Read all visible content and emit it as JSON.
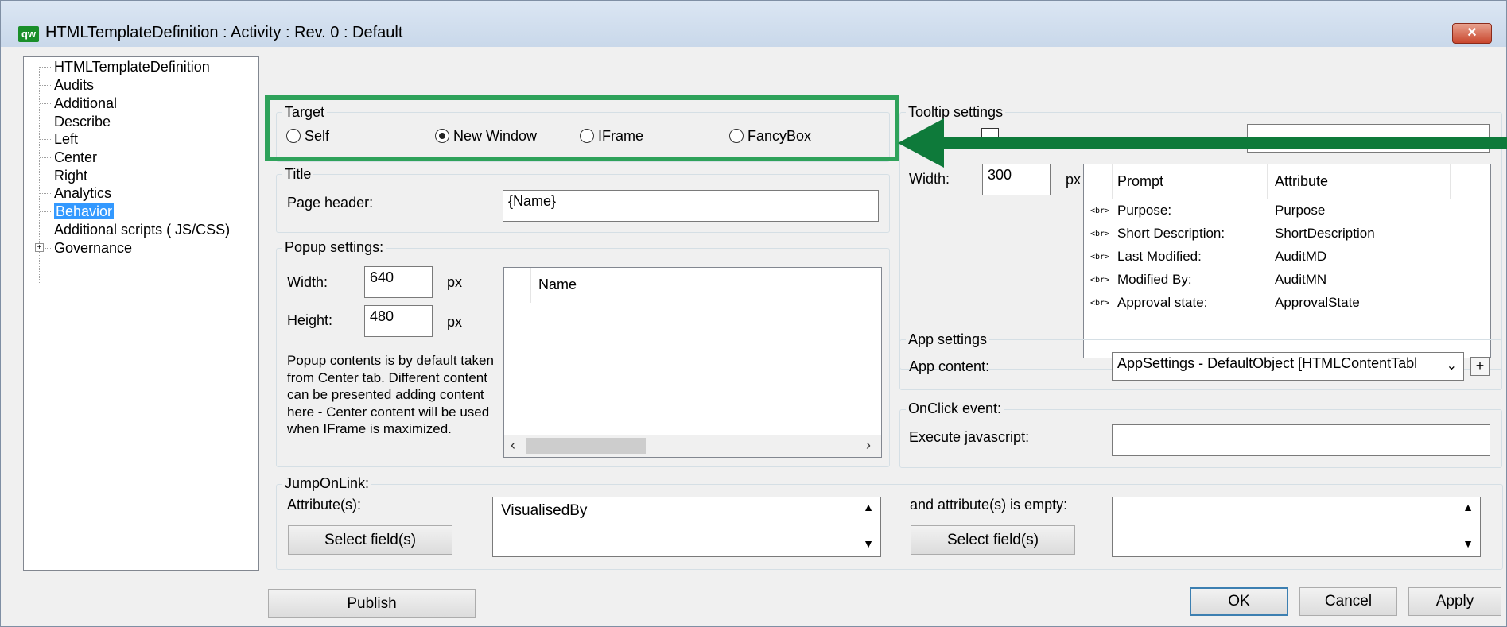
{
  "window": {
    "title": "HTMLTemplateDefinition : Activity : Rev. 0  : Default",
    "icon_text": "qw",
    "close_glyph": "✕"
  },
  "tree": {
    "items": [
      {
        "label": "HTMLTemplateDefinition"
      },
      {
        "label": "Audits"
      },
      {
        "label": "Additional"
      },
      {
        "label": "Describe"
      },
      {
        "label": "Left"
      },
      {
        "label": "Center"
      },
      {
        "label": "Right"
      },
      {
        "label": "Analytics"
      },
      {
        "label": "Behavior"
      },
      {
        "label": "Additional scripts ( JS/CSS)"
      },
      {
        "label": "Governance"
      }
    ],
    "selected": "Behavior"
  },
  "target": {
    "legend": "Target",
    "options": [
      {
        "label": "Self",
        "checked": false
      },
      {
        "label": "New Window",
        "checked": true
      },
      {
        "label": "IFrame",
        "checked": false
      },
      {
        "label": "FancyBox",
        "checked": false
      }
    ]
  },
  "title_group": {
    "legend": "Title",
    "page_header_label": "Page header:",
    "page_header_value": "{Name}"
  },
  "popup": {
    "legend": "Popup settings:",
    "width_label": "Width:",
    "width_value": "640",
    "height_label": "Height:",
    "height_value": "480",
    "unit": "px",
    "note": "Popup contents is by default taken from Center tab. Different content can be presented adding content here - Center content will be used when IFrame is maximized.",
    "list_header": "Name"
  },
  "jump": {
    "legend": "JumpOnLink:",
    "attr_label": "Attribute(s):",
    "attr_value": "VisualisedBy",
    "select_btn": "Select field(s)",
    "empty_label": "and attribute(s) is empty:",
    "select_btn2": "Select field(s)"
  },
  "tooltip": {
    "legend": "Tooltip settings",
    "width_label": "Width:",
    "width_value": "300",
    "unit": "px",
    "headers": {
      "prompt": "Prompt",
      "attribute": "Attribute"
    },
    "br_tag": "<br>",
    "rows": [
      {
        "prompt": "Purpose:",
        "attribute": "Purpose"
      },
      {
        "prompt": "Short Description:",
        "attribute": "ShortDescription"
      },
      {
        "prompt": "Last Modified:",
        "attribute": "AuditMD"
      },
      {
        "prompt": "Modified By:",
        "attribute": "AuditMN"
      },
      {
        "prompt": "Approval state:",
        "attribute": "ApprovalState"
      }
    ]
  },
  "app": {
    "legend": "App settings",
    "content_label": "App content:",
    "content_value": "AppSettings - DefaultObject [HTMLContentTabl",
    "plus": "+"
  },
  "onclick": {
    "legend": "OnClick event:",
    "exec_label": "Execute javascript:",
    "exec_value": ""
  },
  "buttons": {
    "publish": "Publish",
    "ok": "OK",
    "cancel": "Cancel",
    "apply": "Apply"
  },
  "colors": {
    "highlight": "#2ea25a",
    "arrow": "#0e7a3a",
    "selection": "#3399ff"
  }
}
